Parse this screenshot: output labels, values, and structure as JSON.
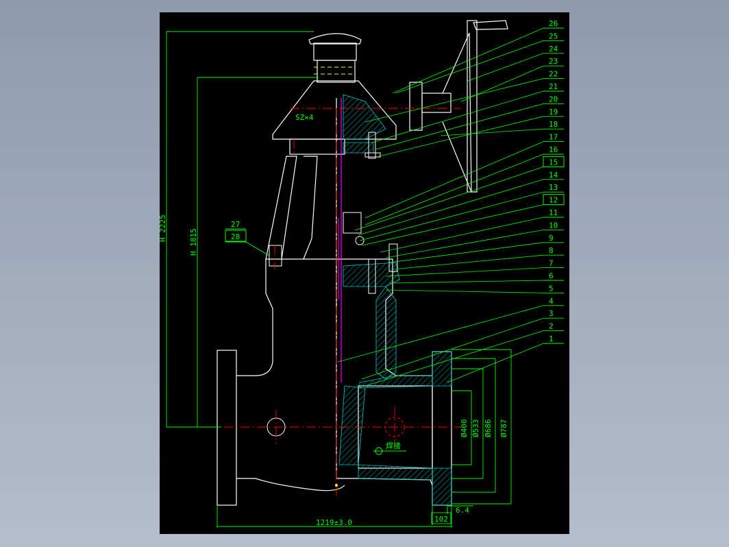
{
  "drawing": {
    "part_numbers": [
      "1",
      "2",
      "3",
      "4",
      "5",
      "6",
      "7",
      "8",
      "9",
      "10",
      "11",
      "12",
      "13",
      "14",
      "15",
      "16",
      "17",
      "18",
      "19",
      "20",
      "21",
      "22",
      "23",
      "24",
      "25",
      "26"
    ],
    "side_labels": [
      "27",
      "28"
    ],
    "bolt_note": "SZ×4",
    "dims": {
      "height_max": "H 2225",
      "height_min": "H 1815",
      "d1": "Ø400",
      "d2": "Ø533",
      "d3": "Ø686",
      "d4": "Ø787",
      "length": "1219±3.0",
      "flange": "102",
      "thickness": "6.4"
    },
    "weld_note": "焊接"
  },
  "colors": {
    "background": "#000000",
    "leader": "#00ff00",
    "outline": "#ffffff",
    "centerline": "#ff0000",
    "hatch": "#00c8c8",
    "seal": "#ff00ff",
    "accent": "#ffff00"
  }
}
